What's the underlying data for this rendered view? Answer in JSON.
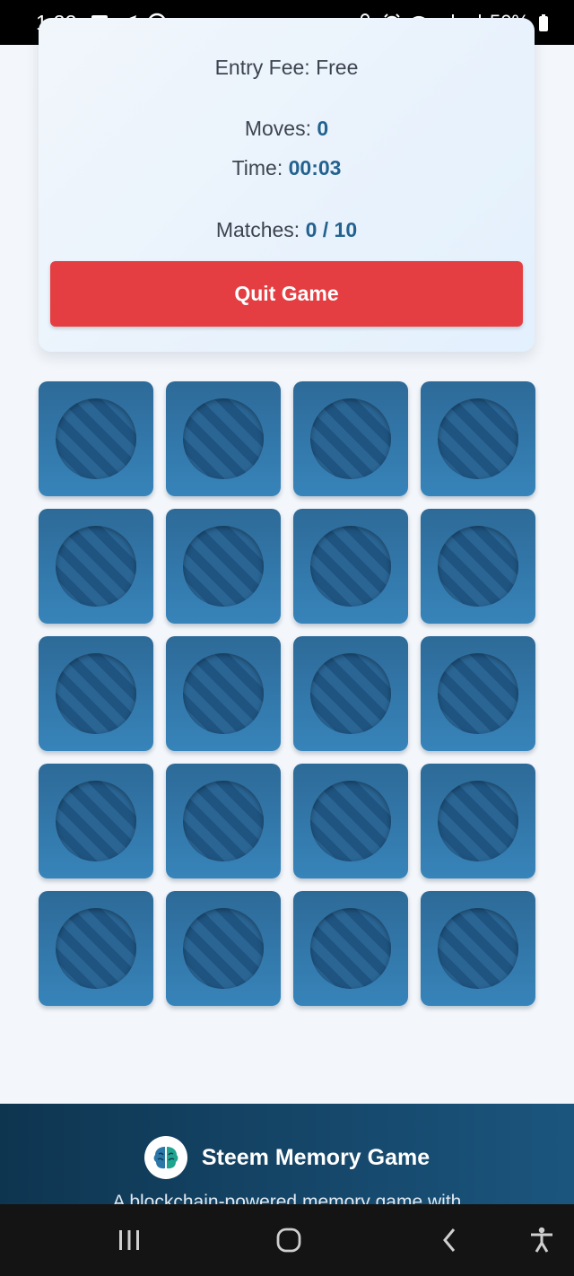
{
  "status_bar": {
    "time": "1:22",
    "battery": "50%",
    "left_icons": [
      "gallery-icon",
      "telegram-icon",
      "chrome-icon"
    ],
    "right_icons": [
      "lock-icon",
      "alarm-icon",
      "wifi-icon",
      "signal-icon",
      "signal-icon",
      "battery-icon"
    ]
  },
  "game_info": {
    "entry_fee_label": "Entry Fee:",
    "entry_fee_value": "Free",
    "moves_label": "Moves:",
    "moves_value": "0",
    "time_label": "Time:",
    "time_value": "00:03",
    "matches_label": "Matches:",
    "matches_value": "0 / 10",
    "quit_label": "Quit Game"
  },
  "board": {
    "columns": 4,
    "rows": 5,
    "card_count": 20,
    "card_back_icon": "striped-circle-icon"
  },
  "footer": {
    "title": "Steem Memory Game",
    "tagline": "A blockchain-powered memory game with",
    "logo_icon": "brain-icon"
  },
  "nav_bar": {
    "buttons": [
      "recent-apps-icon",
      "home-icon",
      "back-icon",
      "accessibility-icon"
    ]
  },
  "colors": {
    "accent": "#23628f",
    "quit_button": "#e53e42",
    "card_blue": "#3784ba",
    "footer_bg": "#0e3550"
  }
}
